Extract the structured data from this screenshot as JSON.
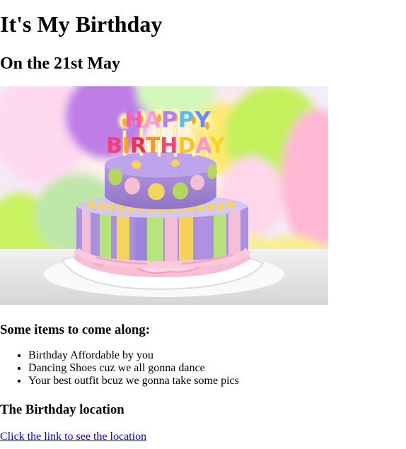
{
  "page": {
    "title": "It's My Birthday",
    "subtitle": "On the 21st May"
  },
  "hero_image": {
    "banner_text": "HAPPY BIRTHDAY",
    "colors": {
      "balloon_purple": "#b58ce7",
      "balloon_green": "#b9f05b",
      "balloon_yellow": "#ffe86b",
      "balloon_pink": "#ffbddd",
      "cake_purple": "#a489d8",
      "cake_pink": "#f7bfd5",
      "cake_yellow": "#f6d35d",
      "cake_green": "#b7e47d"
    }
  },
  "items": {
    "heading": "Some items to come along:",
    "list": [
      "Birthday Affordable by you",
      "Dancing Shoes cuz we all gonna dance",
      "Your best outfit bcuz we gonna take some pics"
    ]
  },
  "location": {
    "heading": "The Birthday location",
    "link_text": "Click the link to see the location"
  }
}
